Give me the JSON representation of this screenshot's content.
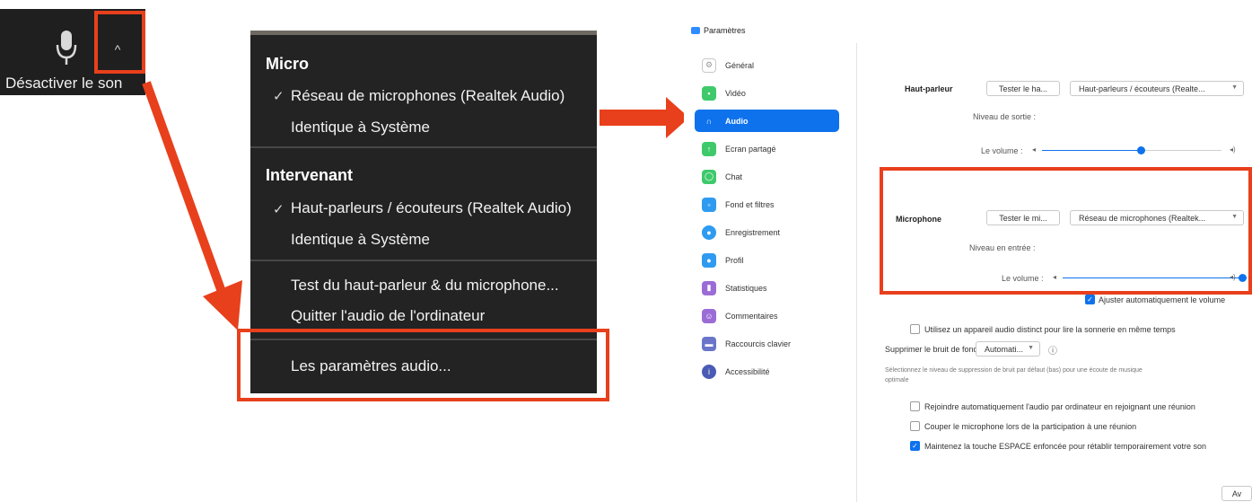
{
  "toolbar": {
    "mute_label": "Désactiver le son",
    "caret": "^"
  },
  "audio_menu": {
    "micro_header": "Micro",
    "micro_items": [
      {
        "label": "Réseau de microphones (Realtek Audio)",
        "checked": true
      },
      {
        "label": "Identique à Système",
        "checked": false
      }
    ],
    "speaker_header": "Intervenant",
    "speaker_items": [
      {
        "label": "Haut-parleurs / écouteurs (Realtek Audio)",
        "checked": true
      },
      {
        "label": "Identique à Système",
        "checked": false
      }
    ],
    "test_label": "Test du haut-parleur & du microphone...",
    "leave_label": "Quitter l'audio de l'ordinateur",
    "settings_label": "Les paramètres audio..."
  },
  "settings": {
    "window_title": "Paramètres",
    "nav": [
      {
        "label": "Général",
        "icon": "gear-icon",
        "color": "#c8c8c8"
      },
      {
        "label": "Vidéo",
        "icon": "video-icon",
        "color": "#3ec96b"
      },
      {
        "label": "Audio",
        "icon": "headphones-icon",
        "color": "#0e72ed"
      },
      {
        "label": "Ecran partagé",
        "icon": "share-screen-icon",
        "color": "#3ec96b"
      },
      {
        "label": "Chat",
        "icon": "chat-icon",
        "color": "#3ec96b"
      },
      {
        "label": "Fond et filtres",
        "icon": "background-icon",
        "color": "#2e9bf0"
      },
      {
        "label": "Enregistrement",
        "icon": "record-icon",
        "color": "#2e9bf0"
      },
      {
        "label": "Profil",
        "icon": "profile-icon",
        "color": "#2e9bf0"
      },
      {
        "label": "Statistiques",
        "icon": "statistics-icon",
        "color": "#9b6cd6"
      },
      {
        "label": "Commentaires",
        "icon": "feedback-icon",
        "color": "#9b6cd6"
      },
      {
        "label": "Raccourcis clavier",
        "icon": "keyboard-icon",
        "color": "#6a74c9"
      },
      {
        "label": "Accessibilité",
        "icon": "accessibility-icon",
        "color": "#4a5bb5"
      }
    ],
    "speaker": {
      "label": "Haut-parleur",
      "test_btn": "Tester le ha...",
      "device": "Haut-parleurs / écouteurs (Realte...",
      "level_label": "Niveau de sortie :",
      "volume_label": "Le volume :",
      "volume_level": 0.55
    },
    "microphone": {
      "label": "Microphone",
      "test_btn": "Tester le mi...",
      "device": "Réseau de microphones (Realtek...",
      "level_label": "Niveau en entrée :",
      "volume_label": "Le volume :",
      "volume_level": 0.8,
      "auto_adjust": "Ajuster automatiquement le volume"
    },
    "separate_device": "Utilisez un appareil audio distinct pour lire la sonnerie en même temps",
    "noise_label": "Supprimer le bruit de fond",
    "noise_value": "Automati...",
    "noise_help_1": "Sélectionnez le niveau de suppression de bruit par défaut (bas) pour une écoute de musique",
    "noise_help_2": "optimale",
    "options": [
      {
        "label": "Rejoindre automatiquement l'audio par ordinateur en rejoignant une réunion",
        "checked": false
      },
      {
        "label": "Couper le microphone lors de la participation à une réunion",
        "checked": false
      },
      {
        "label": "Maintenez la touche ESPACE enfoncée pour rétablir temporairement votre son",
        "checked": true
      }
    ],
    "advanced_btn": "Av"
  },
  "colors": {
    "highlight": "#e8401c",
    "accent": "#0e72ed",
    "menu_bg": "#232323"
  }
}
